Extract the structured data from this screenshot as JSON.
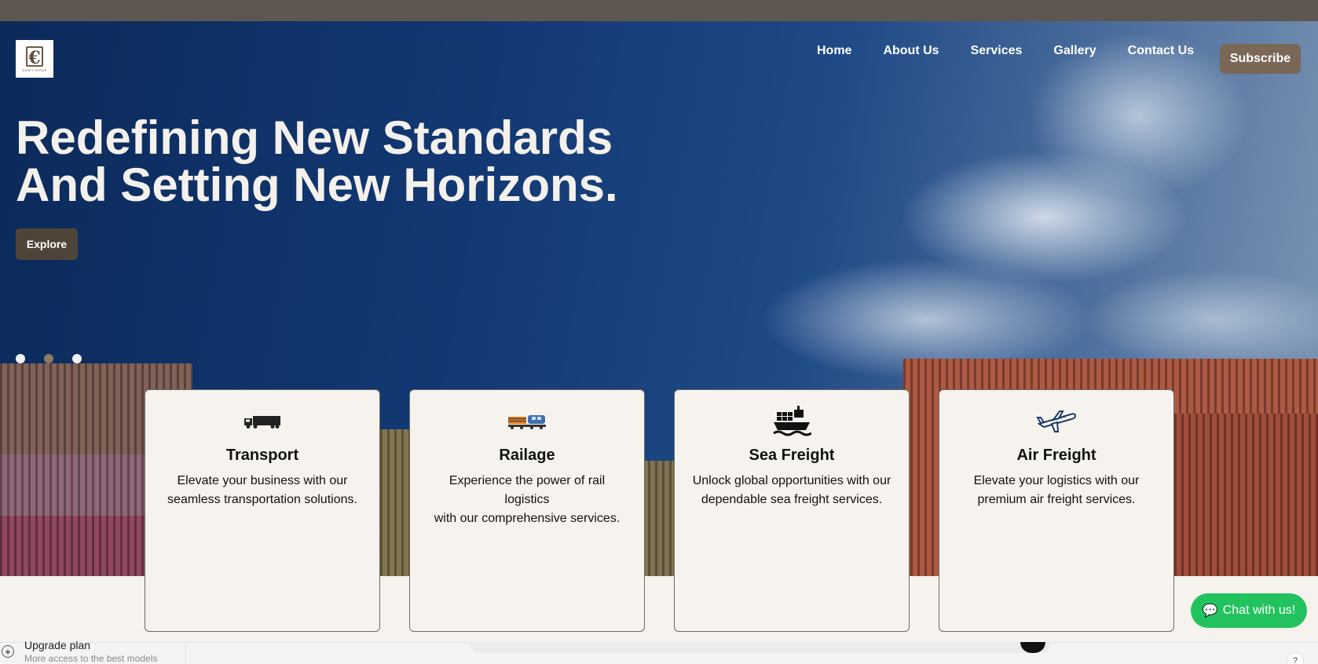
{
  "nav": {
    "items": [
      {
        "label": "Home"
      },
      {
        "label": "About Us"
      },
      {
        "label": "Services"
      },
      {
        "label": "Gallery"
      },
      {
        "label": "Contact Us"
      }
    ],
    "subscribe_label": "Subscribe"
  },
  "logo": {
    "text": "ASSET GROUP"
  },
  "hero": {
    "headline_line1": "Redefining New Standards",
    "headline_line2": "And Setting New Horizons.",
    "explore_label": "Explore",
    "slide_count": 3,
    "active_slide": 1
  },
  "services": [
    {
      "icon": "truck-icon",
      "title": "Transport",
      "desc_line1": "Elevate your business with our",
      "desc_line2": "seamless transportation solutions."
    },
    {
      "icon": "train-icon",
      "title": "Railage",
      "desc_line1": "Experience the power of rail logistics",
      "desc_line2": "with our comprehensive services."
    },
    {
      "icon": "ship-icon",
      "title": "Sea Freight",
      "desc_line1": "Unlock global opportunities with our",
      "desc_line2": "dependable sea freight services."
    },
    {
      "icon": "airplane-icon",
      "title": "Air Freight",
      "desc_line1": "Elevate your logistics with our",
      "desc_line2": "premium air freight services."
    }
  ],
  "chat": {
    "label": "Chat with us!"
  },
  "overlay": {
    "upgrade_title": "Upgrade plan",
    "upgrade_sub": "More access to the best models",
    "help": "?"
  },
  "colors": {
    "brand_brown": "#7a6756",
    "explore_bg": "#4f4438",
    "chat_green": "#22c35e",
    "card_bg": "#f6f3ee"
  }
}
